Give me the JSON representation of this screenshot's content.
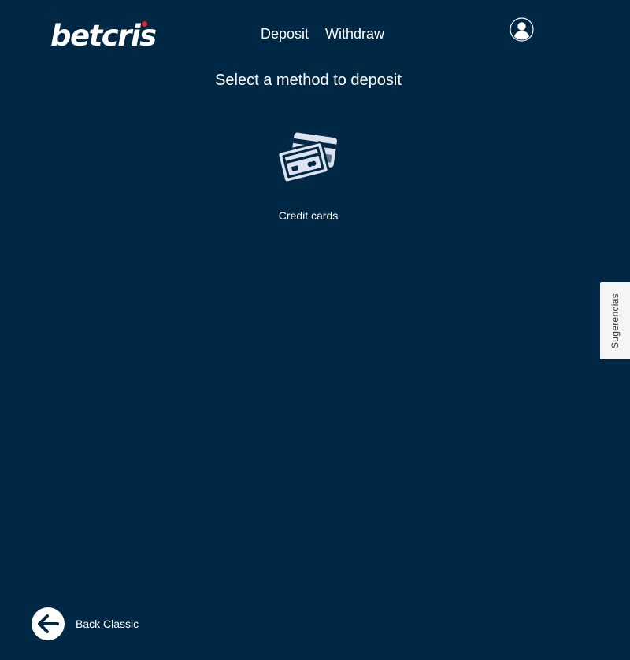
{
  "header": {
    "logo_text": "betcris",
    "nav": [
      {
        "label": "Deposit"
      },
      {
        "label": "Withdraw"
      }
    ],
    "user_icon": "user-circle-icon"
  },
  "main": {
    "title": "Select a method to deposit",
    "methods": [
      {
        "label": "Credit cards",
        "icon": "credit-cards-icon"
      }
    ]
  },
  "feedback_tab": {
    "label": "Sugerencias"
  },
  "footer": {
    "back_label": "Back Classic",
    "back_icon": "arrow-left-icon"
  },
  "colors": {
    "background": "#002744",
    "brand_red": "#e4202a",
    "icon_fill": "#dce3ef"
  }
}
